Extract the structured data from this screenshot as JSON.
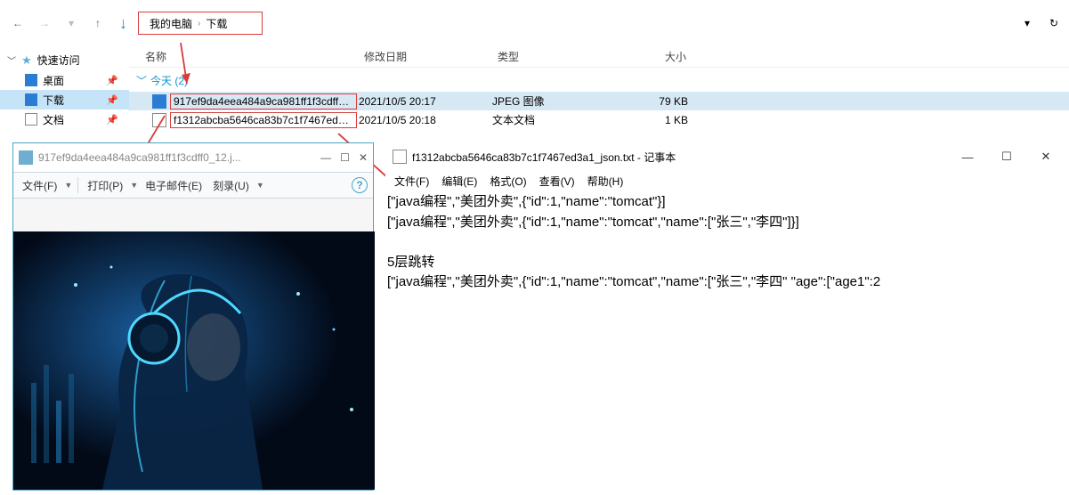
{
  "toolbar": {
    "breadcrumb": [
      "我的电脑",
      "下载"
    ]
  },
  "sidebar": {
    "header": "快速访问",
    "items": [
      {
        "label": "桌面"
      },
      {
        "label": "下载"
      },
      {
        "label": "文档"
      }
    ]
  },
  "columns": {
    "name": "名称",
    "modified": "修改日期",
    "type": "类型",
    "size": "大小"
  },
  "group": {
    "label": "今天 (2)"
  },
  "files": [
    {
      "name": "917ef9da4eea484a9ca981ff1f3cdff0_...",
      "modified": "2021/10/5 20:17",
      "type": "JPEG 图像",
      "size": "79 KB"
    },
    {
      "name": "f1312abcba5646ca83b7c1f7467ed3a...",
      "modified": "2021/10/5 20:18",
      "type": "文本文档",
      "size": "1 KB"
    }
  ],
  "imgviewer": {
    "title": "917ef9da4eea484a9ca981ff1f3cdff0_12.j...",
    "menu": {
      "file": "文件(F)",
      "print": "打印(P)",
      "email": "电子邮件(E)",
      "record": "刻录(U)"
    }
  },
  "notepad": {
    "title": "f1312abcba5646ca83b7c1f7467ed3a1_json.txt - 记事本",
    "menu": {
      "file": "文件(F)",
      "edit": "编辑(E)",
      "format": "格式(O)",
      "view": "查看(V)",
      "help": "帮助(H)"
    },
    "lines": [
      "[\"java编程\",\"美团外卖\",{\"id\":1,\"name\":\"tomcat\"}]",
      "[\"java编程\",\"美团外卖\",{\"id\":1,\"name\":\"tomcat\",\"name\":[\"张三\",\"李四\"]}]",
      "",
      "5层跳转",
      "[\"java编程\",\"美团外卖\",{\"id\":1,\"name\":\"tomcat\",\"name\":[\"张三\",\"李四\" \"age\":[\"age1\":2"
    ]
  }
}
